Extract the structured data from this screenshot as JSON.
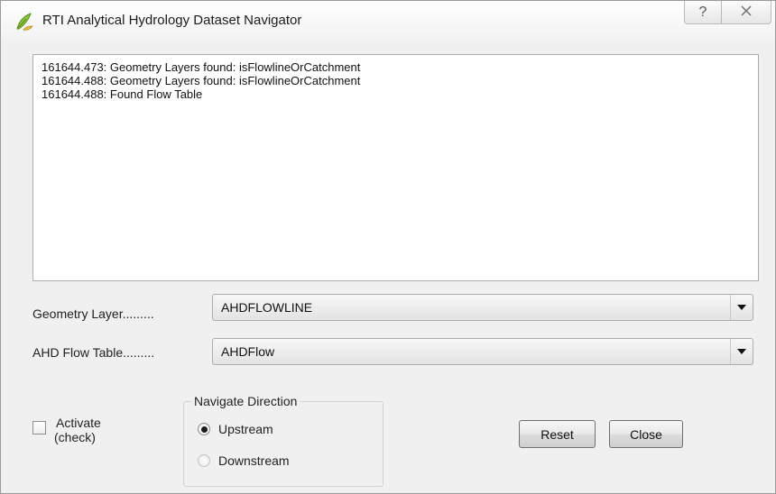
{
  "window": {
    "title": "RTI Analytical Hydrology Dataset Navigator",
    "help_glyph": "?",
    "close_glyph": "×"
  },
  "log": {
    "lines": [
      "161644.473: Geometry Layers found: isFlowlineOrCatchment",
      "161644.488: Geometry Layers found: isFlowlineOrCatchment",
      "161644.488: Found Flow Table"
    ]
  },
  "geometry_layer": {
    "label": "Geometry Layer.........",
    "value": "AHDFLOWLINE"
  },
  "flow_table": {
    "label": "AHD Flow Table.........",
    "value": "AHDFlow"
  },
  "activate": {
    "label_line1": "Activate",
    "label_line2": "(check)",
    "checked": false
  },
  "navigate_direction": {
    "title": "Navigate Direction",
    "options": [
      {
        "label": "Upstream",
        "selected": true
      },
      {
        "label": "Downstream",
        "selected": false
      }
    ]
  },
  "buttons": {
    "reset": "Reset",
    "close": "Close"
  }
}
